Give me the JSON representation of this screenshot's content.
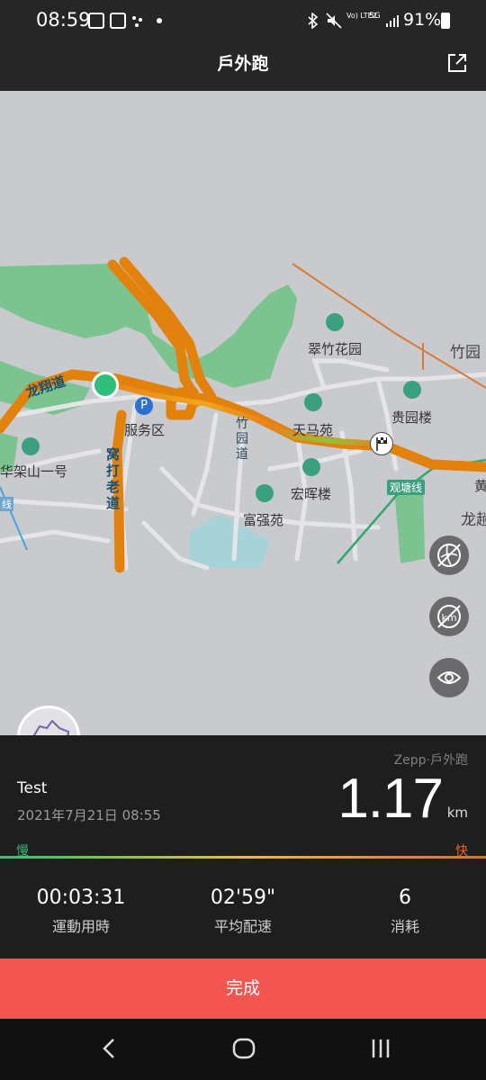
{
  "status_bar": {
    "time": "08:59",
    "right_text": "91%",
    "network": "Vo) LTE2",
    "network_type": "5G"
  },
  "header": {
    "title": "戶外跑"
  },
  "map": {
    "labels": {
      "longxiang": "龙翔道",
      "service": "服务区",
      "huajia": "华架山一号",
      "dadao": "窝打老道",
      "huaqiao": "竹园道",
      "cuizhu": "翠竹花园",
      "zhuyuan": "竹园",
      "tianma": "天马苑",
      "guiyuan": "贵园楼",
      "honghui": "宏晖楼",
      "fuqiang": "富强苑",
      "guantang": "观塘线",
      "huang": "黄",
      "longzhao": "龙趟",
      "xian": "线"
    }
  },
  "workout": {
    "brand": "Zepp·戶外跑",
    "user": "Test",
    "datetime": "2021年7月21日 08:55",
    "distance": "1.17",
    "unit": "km",
    "slow": "慢",
    "fast": "快",
    "stats": [
      {
        "value": "00:03:31",
        "label": "運動用時"
      },
      {
        "value": "02'59\"",
        "label": "平均配速"
      },
      {
        "value": "6",
        "label": "消耗"
      }
    ]
  },
  "done_button": {
    "label": "完成"
  },
  "colors": {
    "accent": "#f25550",
    "route": "#e8821e",
    "slow": "#3fb57a",
    "fast": "#e86a24"
  }
}
